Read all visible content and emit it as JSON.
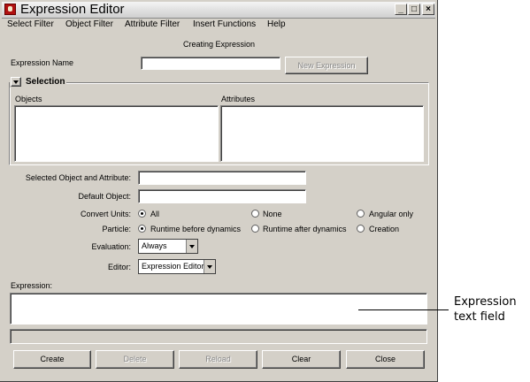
{
  "window": {
    "title": "Expression Editor",
    "controls": {
      "minimize": "_",
      "maximize": "□",
      "close": "×"
    }
  },
  "menu": [
    "Select Filter",
    "Object Filter",
    "Attribute Filter",
    "Insert Functions",
    "Help"
  ],
  "status": "Creating Expression",
  "expression_name": {
    "label": "Expression Name",
    "value": "",
    "button": "New Expression"
  },
  "selection": {
    "label": "Selection",
    "objects_header": "Objects",
    "attributes_header": "Attributes"
  },
  "selected_obj_attr": {
    "label": "Selected Object and Attribute:",
    "value": ""
  },
  "default_object": {
    "label": "Default Object:",
    "value": ""
  },
  "convert_units": {
    "label": "Convert Units:",
    "options": [
      "All",
      "None",
      "Angular only"
    ],
    "selected": "All"
  },
  "particle": {
    "label": "Particle:",
    "options": [
      "Runtime before dynamics",
      "Runtime after dynamics",
      "Creation"
    ],
    "selected": "Runtime before dynamics"
  },
  "evaluation": {
    "label": "Evaluation:",
    "value": "Always"
  },
  "editor": {
    "label": "Editor:",
    "value": "Expression Editor"
  },
  "expression": {
    "label": "Expression:",
    "value": ""
  },
  "buttons": {
    "create": "Create",
    "delete": "Delete",
    "reload": "Reload",
    "clear": "Clear",
    "close": "Close"
  },
  "annotation": {
    "line1": "Expression",
    "line2": "text field"
  },
  "icons": {
    "app": "maya-app-icon",
    "collapse": "triangle-down-icon",
    "dropdown": "dropdown-arrow-icon"
  }
}
